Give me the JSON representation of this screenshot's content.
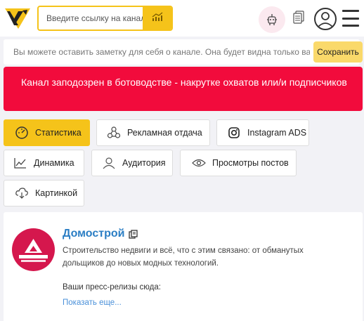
{
  "header": {
    "search_placeholder": "Введите ссылку на канал",
    "icons": [
      "logo-icon",
      "analytics-icon",
      "robot-icon",
      "cards-icon",
      "user-icon",
      "menu-icon"
    ]
  },
  "note": {
    "text": "Вы можете оставить заметку для себя о канале. Она будет видна только вам",
    "save_label": "Сохранить"
  },
  "alert": {
    "text": "Канал заподозрен в ботоводстве - накрутке охватов или/и подписчиков",
    "color": "#f20b3c"
  },
  "tabs": [
    {
      "label": "Статистика",
      "icon": "speedometer-icon",
      "active": true
    },
    {
      "label": "Рекламная отдача",
      "icon": "ads-icon"
    },
    {
      "label": "Instagram ADS",
      "icon": "instagram-icon"
    },
    {
      "label": "Динамика",
      "icon": "chart-icon"
    },
    {
      "label": "Аудитория",
      "icon": "audience-icon"
    },
    {
      "label": "Просмотры постов",
      "icon": "eye-icon"
    },
    {
      "label": "Картинкой",
      "icon": "cloud-download-icon"
    }
  ],
  "channel": {
    "title": "Домострой",
    "description": "Строительство недвиги и всё, что с этим связано: от обманутых дольщиков до новых модных технологий.",
    "press": "Ваши пресс-релизы сюда:",
    "more_label": "Показать еще..."
  },
  "colors": {
    "accent": "#f5c31a",
    "alert": "#f20b3c",
    "link": "#2b7ec4",
    "avatar": "#d5174d"
  }
}
